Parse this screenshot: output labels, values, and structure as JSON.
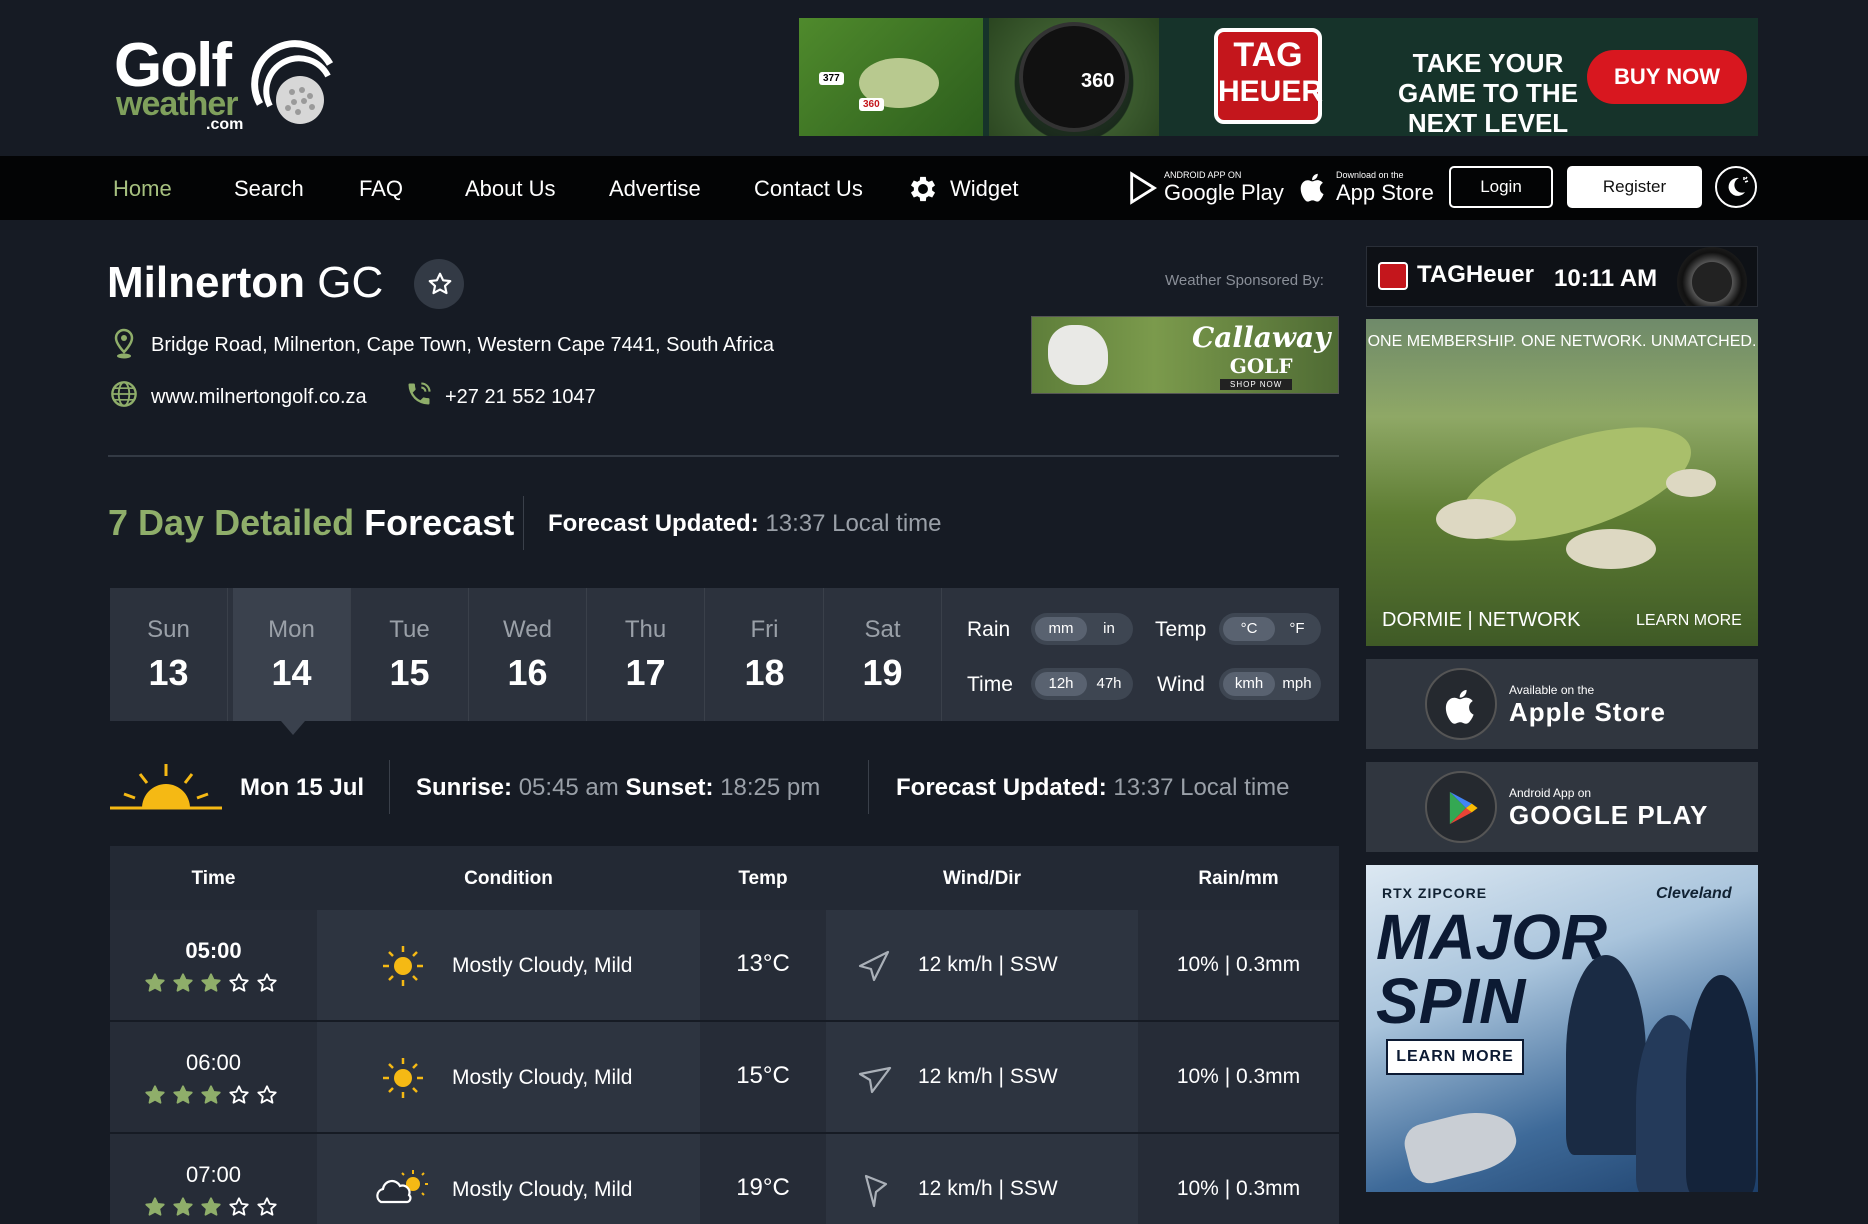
{
  "logo": {
    "line1": "Golf",
    "line2": "weather",
    "line3": ".com"
  },
  "top_ad": {
    "pin_a": "377",
    "pin_b": "360",
    "watch_text": "360",
    "brand_line1": "TAG",
    "brand_line2": "HEUER",
    "slogan": "TAKE YOUR GAME TO THE NEXT LEVEL",
    "cta": "BUY NOW"
  },
  "nav": {
    "items": [
      "Home",
      "Search",
      "FAQ",
      "About Us",
      "Advertise",
      "Contact Us",
      "Widget"
    ],
    "active": "Home",
    "google_small": "ANDROID APP ON",
    "google_big": "Google Play",
    "apple_small": "Download on the",
    "apple_big": "App Store",
    "login": "Login",
    "register": "Register"
  },
  "course": {
    "name": "Milnerton",
    "suffix": "GC",
    "address": "Bridge Road, Milnerton, Cape Town, Western Cape 7441, South Africa",
    "website": "www.milnertongolf.co.za",
    "phone": "+27 21 552 1047"
  },
  "sponsor": {
    "label": "Weather Sponsored By:",
    "brand": "Callaway",
    "brand2": "GOLF",
    "shop": "SHOP NOW"
  },
  "forecast": {
    "title_green": "7 Day Detailed",
    "title_white": "Forecast",
    "updated_label": "Forecast Updated:",
    "updated_value": "13:37 Local time"
  },
  "days": [
    {
      "name": "Sun",
      "date": "13"
    },
    {
      "name": "Mon",
      "date": "14"
    },
    {
      "name": "Tue",
      "date": "15"
    },
    {
      "name": "Wed",
      "date": "16"
    },
    {
      "name": "Thu",
      "date": "17"
    },
    {
      "name": "Fri",
      "date": "18"
    },
    {
      "name": "Sat",
      "date": "19"
    }
  ],
  "selected_day_index": 1,
  "units": {
    "rain": {
      "label": "Rain",
      "on": "mm",
      "off": "in"
    },
    "temp": {
      "label": "Temp",
      "on": "°C",
      "off": "°F"
    },
    "time": {
      "label": "Time",
      "on": "12h",
      "off": "47h"
    },
    "wind": {
      "label": "Wind",
      "on": "kmh",
      "off": "mph"
    }
  },
  "day_info": {
    "date": "Mon 15 Jul",
    "sunrise_label": "Sunrise:",
    "sunrise": "05:45 am",
    "sunset_label": "Sunset:",
    "sunset": "18:25 pm",
    "updated_label": "Forecast Updated:",
    "updated_value": "13:37 Local time"
  },
  "table": {
    "headers": [
      "Time",
      "Condition",
      "Temp",
      "Wind/Dir",
      "Rain/mm"
    ],
    "rows": [
      {
        "time": "05:00",
        "stars": 3,
        "condition": "Mostly Cloudy, Mild",
        "icon": "sun-icon",
        "temp": "13°C",
        "wind": "12 km/h   |   SSW",
        "rain": "10%   |   0.3mm"
      },
      {
        "time": "06:00",
        "stars": 3,
        "condition": "Mostly Cloudy, Mild",
        "icon": "sun-icon",
        "temp": "15°C",
        "wind": "12 km/h   |   SSW",
        "rain": "10%   |   0.3mm"
      },
      {
        "time": "07:00",
        "stars": 3,
        "condition": "Mostly Cloudy, Mild",
        "icon": "cloud-sun-icon",
        "temp": "19°C",
        "wind": "12 km/h   |   SSW",
        "rain": "10%   |   0.3mm"
      }
    ]
  },
  "sidebar": {
    "clock_brand": "TAGHeuer",
    "clock_time": "10:11 AM",
    "dormie_head": "ONE MEMBERSHIP. ONE NETWORK. UNMATCHED.",
    "dormie_logo": "DORMIE | NETWORK",
    "dormie_cta": "LEARN MORE",
    "apple_small": "Available on the",
    "apple_big": "Apple Store",
    "google_small": "Android App on",
    "google_big": "GOOGLE PLAY",
    "spin_tag": "RTX ZIPCORE",
    "spin_brand": "Cleveland",
    "spin_line1": "MAJOR",
    "spin_line2": "SPIN",
    "spin_cta": "LEARN MORE"
  },
  "colors": {
    "background": "#161b24",
    "accent_green": "#8fae6a",
    "star_green": "#8fae6a",
    "sun_yellow": "#f5b914",
    "nav_bg": "#030405"
  }
}
